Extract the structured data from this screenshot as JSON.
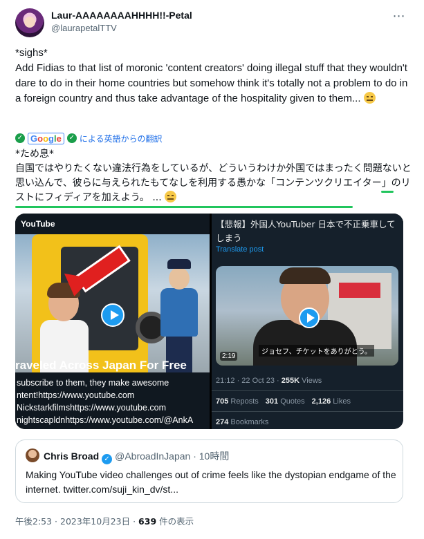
{
  "author": {
    "display_name": "Laur-AAAAAAAAHHHH!!-Petal",
    "handle": "@laurapetalTTV"
  },
  "tweet": {
    "lines": [
      "*sighs*",
      "Add Fidias to that list of moronic 'content creators' doing illegal stuff that they wouldn't dare to do in their home countries but somehow think it's totally not a problem to do in a foreign country and thus take advantage of the hospitality given to them... "
    ],
    "emoji": "expressionless-face-icon"
  },
  "translation": {
    "google_label": "Google",
    "suffix": "による英語からの翻訳",
    "jp_lines": [
      "*ため息*",
      "自国ではやりたくない違法行為をしているが、どういうわけか外国ではまったく問題ないと思い込んで、彼らに与えられたもてなしを利用する愚かな「コンテンツクリエイター」のリストにフィディアを加えよう。 ... "
    ]
  },
  "media": {
    "left": {
      "brand": "YouTube",
      "title": "raveled Across Japan For Free",
      "desc": [
        "subscribe to them, they make awesome",
        "ntent!https://www.youtube.com",
        "Nickstarkfilmshttps://www.youtube.com",
        "nightscapldnhttps://www.youtube.com/@AnkA"
      ]
    },
    "right": {
      "headline": "【悲報】外国人YouTuber 日本で不正乗車してしまう",
      "translate_post": "Translate post",
      "subtitle": "ジョセフ、チケットをありがとう。",
      "duration": "2:19",
      "time": "21:12 · 22 Oct 23 · ",
      "views_value": "255K",
      "views_label": " Views",
      "reposts_value": "705",
      "reposts_label": " Reposts",
      "quotes_value": "301",
      "quotes_label": " Quotes",
      "likes_value": "2,126",
      "likes_label": " Likes",
      "bookmarks_value": "274",
      "bookmarks_label": " Bookmarks"
    }
  },
  "quote": {
    "name": "Chris Broad",
    "handle": "@AbroadInJapan · 10時間",
    "text": "Making YouTube video challenges out of crime feels like the dystopian endgame of the internet. twitter.com/suji_kin_dv/st..."
  },
  "footer": {
    "timestamp": "午後2:53 · 2023年10月23日 · ",
    "views_value": "639",
    "views_label": " 件の表示"
  },
  "colors": {
    "accent": "#1d9bf0",
    "underline": "#21c55d",
    "dark_card": "#15202b"
  }
}
